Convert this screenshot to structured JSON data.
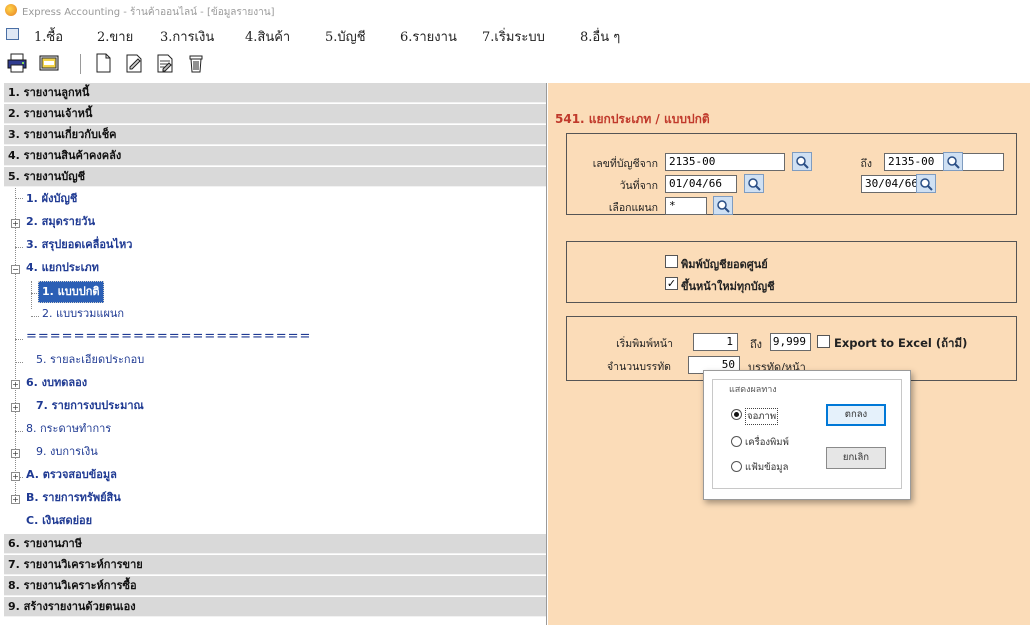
{
  "window": {
    "title": "Express Accounting - ร้านค้าออนไลน์ - [ข้อมูลรายงาน]"
  },
  "menu": [
    {
      "label": "1.ซื้อ"
    },
    {
      "label": "2.ขาย"
    },
    {
      "label": "3.การเงิน"
    },
    {
      "label": "4.สินค้า"
    },
    {
      "label": "5.บัญชี"
    },
    {
      "label": "6.รายงาน"
    },
    {
      "label": "7.เริ่มระบบ"
    },
    {
      "label": "8.อื่น ๆ"
    }
  ],
  "toolbar": {
    "icons": [
      "printer-icon",
      "preview-icon",
      "new-document-icon",
      "edit-document-icon",
      "list-document-icon",
      "delete-icon"
    ]
  },
  "tree": {
    "top_categories": [
      "1. รายงานลูกหนี้",
      "2. รายงานเจ้าหนี้",
      "3. รายงานเกี่ยวกับเช็ค",
      "4. รายงานสินค้าคงคลัง",
      "5. รายงานบัญชี"
    ],
    "children": [
      "1. ผังบัญชี",
      "2. สมุดรายวัน",
      "3. สรุปยอดเคลื่อนไหว",
      "4. แยกประเภท",
      "1. แบบปกติ",
      "2. แบบรวมแผนก",
      "========================",
      "5. รายละเอียดประกอบ",
      "6. งบทดลอง",
      "7. รายการงบประมาณ",
      "8. กระดาษทำการ",
      "9. งบการเงิน",
      "A. ตรวจสอบข้อมูล",
      "B. รายการทรัพย์สิน",
      "C. เงินสดย่อย"
    ],
    "bottom_categories": [
      "6. รายงานภาษี",
      "7. รายงานวิเคราะห์การขาย",
      "8. รายงานวิเคราะห์การซื้อ",
      "9. สร้างรายงานด้วยตนเอง"
    ]
  },
  "form": {
    "title": "541. แยกประเภท / แบบปกติ",
    "account_from_label": "เลขที่บัญชีจาก",
    "account_from": "2135-00",
    "to_label": "ถึง",
    "account_to": "2135-00",
    "date_from_label": "วันที่จาก",
    "date_from": "01/04/66",
    "date_to": "30/04/66",
    "dept_label": "เลือกแผนก",
    "dept": "*",
    "print_zero_label": "พิมพ์บัญชียอดศูนย์",
    "print_zero_checked": false,
    "new_page_label": "ขึ้นหน้าใหม่ทุกบัญชี",
    "new_page_checked": true,
    "page_start_label": "เริ่มพิมพ์หน้า",
    "page_start": "1",
    "page_end": "9,999",
    "export_label": "Export to Excel (ถ้ามี)",
    "export_checked": false,
    "lines_label": "จำนวนบรรทัด",
    "lines": "50",
    "lines_unit": "บรรทัด/หน้า"
  },
  "dialog": {
    "legend": "แสดงผลทาง",
    "options": [
      "จอภาพ",
      "เครื่องพิมพ์",
      "แฟ้มข้อมูล"
    ],
    "selected": "จอภาพ",
    "ok": "ตกลง",
    "cancel": "ยกเลิก"
  }
}
